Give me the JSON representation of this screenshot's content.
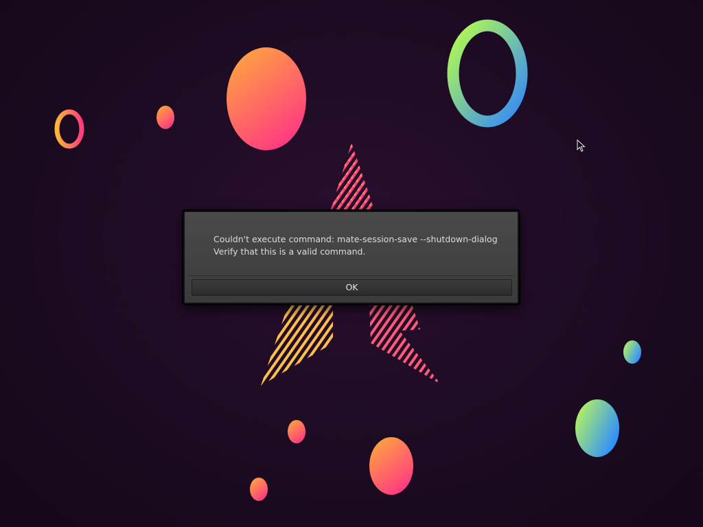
{
  "dialog": {
    "message_line1": "Couldn't execute command: mate-session-save --shutdown-dialog",
    "message_line2": "Verify that this is a valid command.",
    "ok_label": "OK"
  },
  "cursor": {
    "icon": "arrow-pointer-icon"
  },
  "colors": {
    "background": "#1c0b22",
    "dialog_bg": "#444444",
    "text": "#dcdcdc",
    "accent_pink": "#ff3d7f",
    "accent_orange": "#ff9a3c",
    "accent_green": "#a8ff60",
    "accent_blue": "#2f8fff"
  }
}
